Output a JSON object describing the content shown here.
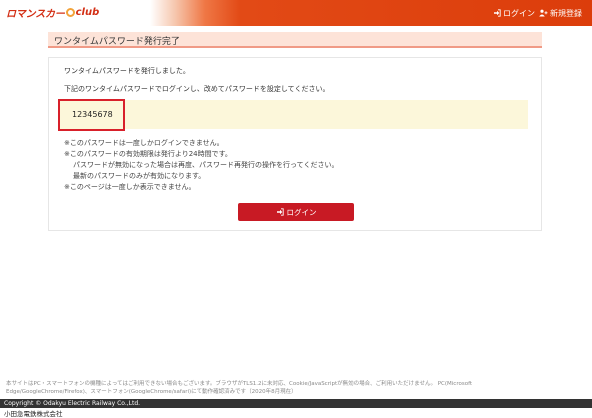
{
  "header": {
    "logo_text": "ロマンスカー",
    "logo_text2": "club",
    "login_label": "ログイン",
    "register_label": "新規登録",
    "login_icon": "sign-in-icon",
    "register_icon": "user-plus-icon"
  },
  "page": {
    "title": "ワンタイムパスワード発行完了",
    "message1": "ワンタイムパスワードを発行しました。",
    "message2": "下記のワンタイムパスワードでログインし、改めてパスワードを設定してください。",
    "password": "12345678",
    "notes": [
      "※このパスワードは一度しかログインできません。",
      "※このパスワードの有効期限は発行より24時間です。",
      "パスワードが無効になった場合は再度、パスワード再発行の操作を行ってください。",
      "最新のパスワードのみが有効になります。",
      "※このページは一度しか表示できません。"
    ],
    "login_button": "ログイン"
  },
  "footer": {
    "disclaimer": "本サイトはPC・スマートフォンの機種によってはご利用できない場合もございます。ブラウザがTLS1.2に未対応、Cookie/JavaScriptが無効の場合、ご利用いただけません。 PC(Microsoft Edge/GoogleChrome/Firefox)、スマートフォン(GoogleChrome/safari)にて動作確認済みです（2020年8月現在）",
    "copyright": "Copyright © Odakyu Electric Railway Co.,Ltd.",
    "company": "小田急電鉄株式会社"
  },
  "colors": {
    "header_red": "#dc3d0b",
    "button_red": "#c81a24",
    "highlight_border": "#d8202a",
    "password_bg": "#fcf7da",
    "title_bg": "#fde3d8"
  }
}
